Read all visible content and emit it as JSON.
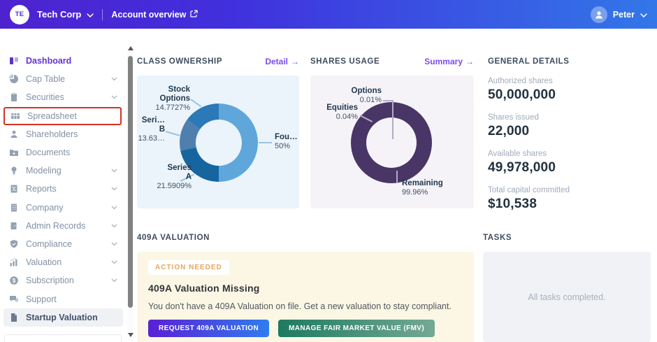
{
  "header": {
    "company_initials": "TE",
    "company_name": "Tech Corp",
    "nav_link": "Account overview",
    "user_name": "Peter"
  },
  "sidebar": {
    "items": [
      {
        "label": "Dashboard",
        "icon": "dashboard-icon",
        "active": true
      },
      {
        "label": "Cap Table",
        "icon": "pie-chart-icon",
        "expandable": true
      },
      {
        "label": "Securities",
        "icon": "clipboard-icon",
        "expandable": true
      },
      {
        "label": "Spreadsheet",
        "icon": "table-icon",
        "highlighted_red": true
      },
      {
        "label": "Shareholders",
        "icon": "person-icon"
      },
      {
        "label": "Documents",
        "icon": "folder-icon"
      },
      {
        "label": "Modeling",
        "icon": "lightbulb-icon",
        "expandable": true
      },
      {
        "label": "Reports",
        "icon": "report-icon",
        "expandable": true
      },
      {
        "label": "Company",
        "icon": "building-icon",
        "expandable": true
      },
      {
        "label": "Admin Records",
        "icon": "records-icon",
        "expandable": true
      },
      {
        "label": "Compliance",
        "icon": "shield-icon",
        "expandable": true
      },
      {
        "label": "Valuation",
        "icon": "growth-chart-icon",
        "expandable": true
      },
      {
        "label": "Subscription",
        "icon": "dollar-icon",
        "expandable": true
      },
      {
        "label": "Support",
        "icon": "chat-icon"
      },
      {
        "label": "Startup Valuation",
        "icon": "file-icon",
        "selected": true
      }
    ]
  },
  "panels": {
    "class_ownership": {
      "title": "CLASS OWNERSHIP",
      "link": {
        "label": "Detail",
        "arrow": "→"
      },
      "chart": {
        "type": "donut",
        "slices": [
          {
            "label": "Fou…",
            "value": 50,
            "display_value": "50%",
            "color": "#5fa7db"
          },
          {
            "label": "Series A",
            "value": 21.5909,
            "display_value": "21.5909%",
            "color": "#16659f"
          },
          {
            "label": "Seri… B",
            "value": 13.6364,
            "display_value": "13.63…",
            "color": "#4f7fae"
          },
          {
            "label": "Stock Options",
            "value": 14.7727,
            "display_value": "14.7727%",
            "color": "#2b79b7"
          }
        ]
      }
    },
    "shares_usage": {
      "title": "SHARES USAGE",
      "link": {
        "label": "Summary",
        "arrow": "→"
      },
      "chart": {
        "type": "donut",
        "slices": [
          {
            "label": "Options",
            "value": 0.01,
            "display_value": "0.01%",
            "color": "#6a5688"
          },
          {
            "label": "Remaining",
            "value": 99.96,
            "display_value": "99.96%",
            "color": "#493566"
          },
          {
            "label": "Equities",
            "value": 0.04,
            "display_value": "0.04%",
            "color": "#8d7ba8"
          }
        ]
      }
    },
    "general_details": {
      "title": "GENERAL DETAILS",
      "stats": [
        {
          "label": "Authorized shares",
          "value": "50,000,000"
        },
        {
          "label": "Shares issued",
          "value": "22,000"
        },
        {
          "label": "Available shares",
          "value": "49,978,000"
        },
        {
          "label": "Total capital committed",
          "value": "$10,538"
        }
      ]
    },
    "valuation_409a": {
      "title": "409A VALUATION",
      "badge": "ACTION NEEDED",
      "heading": "409A Valuation Missing",
      "body": "You don't have a 409A Valuation on file. Get a new valuation to stay compliant.",
      "primary_button": "REQUEST 409A VALUATION",
      "secondary_button": "MANAGE FAIR MARKET VALUE (FMV)"
    },
    "tasks": {
      "title": "TASKS",
      "empty_message": "All tasks completed."
    }
  },
  "chart_data": [
    {
      "type": "pie",
      "title": "CLASS OWNERSHIP",
      "labels": [
        "Fou…",
        "Series A",
        "Seri… B",
        "Stock Options"
      ],
      "values": [
        50,
        21.5909,
        13.6364,
        14.7727
      ],
      "colors": [
        "#5fa7db",
        "#16659f",
        "#4f7fae",
        "#2b79b7"
      ]
    },
    {
      "type": "pie",
      "title": "SHARES USAGE",
      "labels": [
        "Options",
        "Remaining",
        "Equities"
      ],
      "values": [
        0.01,
        99.96,
        0.04
      ],
      "colors": [
        "#6a5688",
        "#493566",
        "#8d7ba8"
      ]
    }
  ]
}
